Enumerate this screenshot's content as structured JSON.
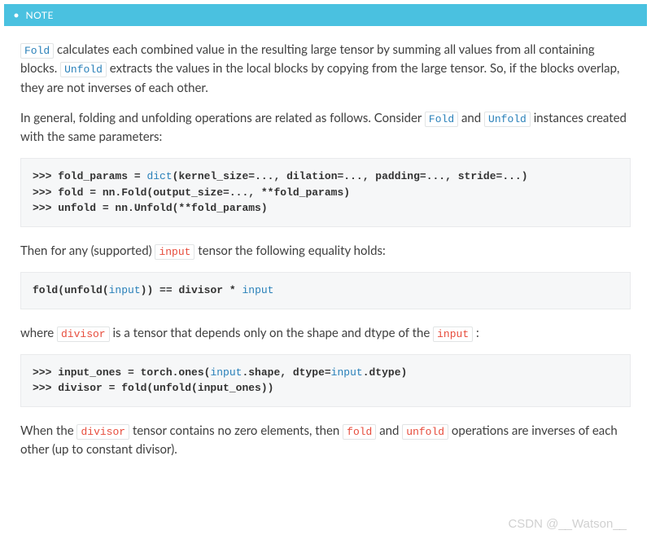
{
  "header": {
    "label": "NOTE"
  },
  "para1": {
    "t0": " calculates each combined value in the resulting large tensor by summing all values from all containing blocks. ",
    "t1": " extracts the values in the local blocks by copying from the large tensor. So, if the blocks overlap, they are not inverses of each other.",
    "fold": "Fold",
    "unfold": "Unfold"
  },
  "para2": {
    "t0": "In general, folding and unfolding operations are related as follows. Consider ",
    "fold": "Fold",
    "t1": " and ",
    "unfold": "Unfold",
    "t2": " instances created with the same parameters:"
  },
  "code1": {
    "l1_pre": ">>> fold_params = ",
    "l1_dict": "dict",
    "l1_post": "(kernel_size=..., dilation=..., padding=..., stride=...)",
    "l2": ">>> fold = nn.Fold(output_size=..., **fold_params)",
    "l3": ">>> unfold = nn.Unfold(**fold_params)"
  },
  "para3": {
    "t0": "Then for any (supported) ",
    "input": "input",
    "t1": " tensor the following equality holds:"
  },
  "code2": {
    "l1_pre": "fold(unfold(",
    "l1_in1": "input",
    "l1_mid": ")) == divisor * ",
    "l1_in2": "input"
  },
  "para4": {
    "t0": "where ",
    "divisor": "divisor",
    "t1": " is a tensor that depends only on the shape and dtype of the ",
    "input": "input",
    "t2": " :"
  },
  "code3": {
    "l1_pre": ">>> input_ones = torch.ones(",
    "l1_in1": "input",
    "l1_mid": ".shape, dtype=",
    "l1_in2": "input",
    "l1_end": ".dtype)",
    "l2": ">>> divisor = fold(unfold(input_ones))"
  },
  "para5": {
    "t0": "When the ",
    "divisor": "divisor",
    "t1": " tensor contains no zero elements, then ",
    "fold": "fold",
    "t2": " and ",
    "unfold": "unfold",
    "t3": " operations are inverses of each other (up to constant divisor)."
  },
  "watermark": "CSDN @__Watson__"
}
